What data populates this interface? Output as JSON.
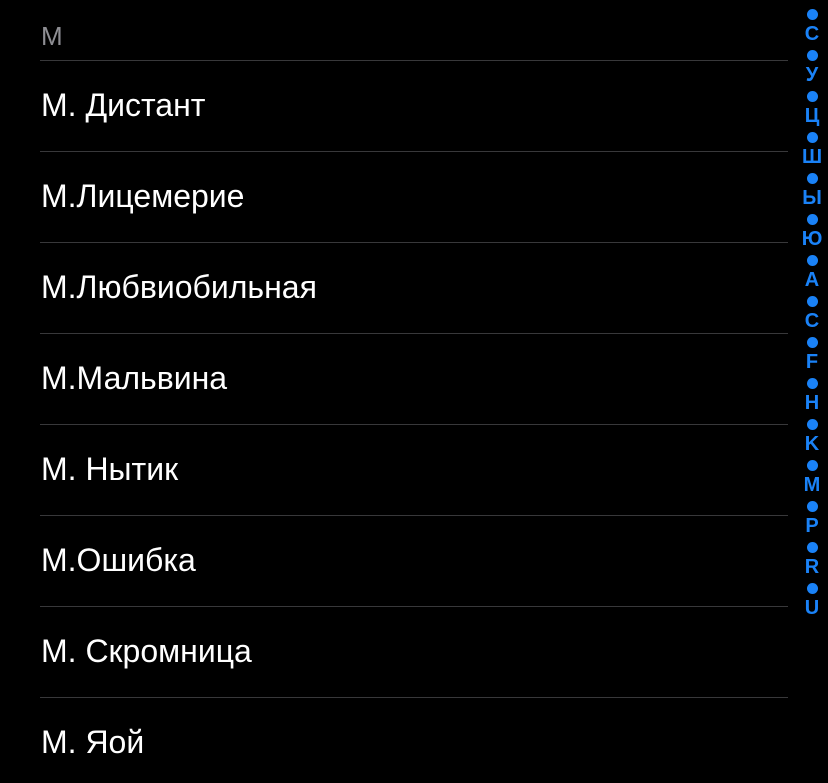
{
  "section": {
    "header": "M"
  },
  "contacts": [
    {
      "name": "М. Дистант"
    },
    {
      "name": "М.Лицемерие"
    },
    {
      "name": "М.Любвиобильная"
    },
    {
      "name": "М.Мальвина"
    },
    {
      "name": "М. Нытик"
    },
    {
      "name": "М.Ошибка"
    },
    {
      "name": "М. Скромница"
    },
    {
      "name": "М. Яой"
    }
  ],
  "index_bar": {
    "accent_color": "#1a82f7",
    "letters": [
      "С",
      "У",
      "Ц",
      "Ш",
      "Ы",
      "Ю",
      "A",
      "C",
      "F",
      "H",
      "K",
      "M",
      "P",
      "R",
      "U"
    ]
  },
  "colors": {
    "background": "#000000",
    "text": "#ffffff",
    "section_header": "#8e8e93",
    "divider": "#38383a"
  }
}
